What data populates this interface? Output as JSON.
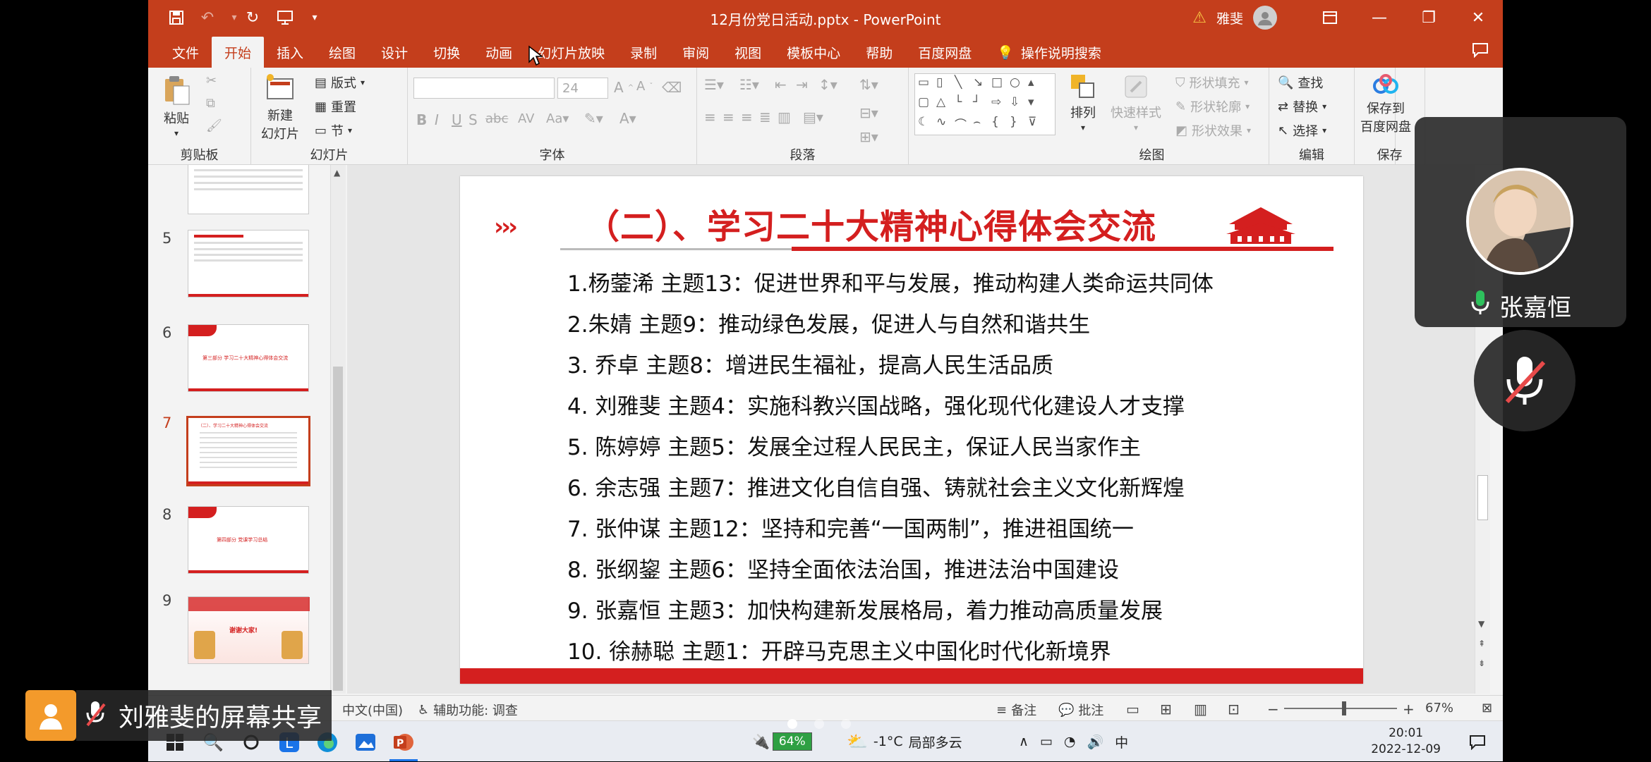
{
  "window": {
    "doc_title": "12月份党日活动.pptx  -  PowerPoint",
    "user_name": "雅斐"
  },
  "tabs": [
    "文件",
    "开始",
    "插入",
    "绘图",
    "设计",
    "切换",
    "动画",
    "幻灯片放映",
    "录制",
    "审阅",
    "视图",
    "模板中心",
    "帮助",
    "百度网盘"
  ],
  "active_tab": "开始",
  "tell_me": "操作说明搜索",
  "ribbon": {
    "clipboard": {
      "label": "剪贴板",
      "paste": "粘贴"
    },
    "slides": {
      "label": "幻灯片",
      "new_slide_1": "新建",
      "new_slide_2": "幻灯片",
      "layout": "版式",
      "reset": "重置",
      "section": "节"
    },
    "font": {
      "label": "字体",
      "size": "24"
    },
    "paragraph": {
      "label": "段落"
    },
    "drawing": {
      "label": "绘图",
      "arrange": "排列",
      "quick_styles": "快速样式",
      "fill": "形状填充",
      "outline": "形状轮廓",
      "effects": "形状效果"
    },
    "editing": {
      "label": "编辑",
      "find": "查找",
      "replace": "替换",
      "select": "选择"
    },
    "save": {
      "label": "保存",
      "save_to_1": "保存到",
      "save_to_2": "百度网盘"
    }
  },
  "thumbnails": [
    {
      "num": "5"
    },
    {
      "num": "6",
      "text": "第三部分 学习二十大精神心得体会交流"
    },
    {
      "num": "7",
      "text": "（二）、学习二十大精神心得体会交流"
    },
    {
      "num": "8",
      "text": "第四部分 党课学习总结"
    },
    {
      "num": "9",
      "text": "谢谢大家!"
    }
  ],
  "slide": {
    "title": "（二）、学习二十大精神心得体会交流",
    "items": [
      "1.杨蓥浠 主题13：促进世界和平与发展，推动构建人类命运共同体",
      "2.朱婧 主题9：推动绿色发展，促进人与自然和谐共生",
      "3. 乔卓 主题8：增进民生福祉，提高人民生活品质",
      "4. 刘雅斐 主题4：实施科教兴国战略，强化现代化建设人才支撑",
      "5. 陈婷婷 主题5：发展全过程人民民主，保证人民当家作主",
      "6. 余志强 主题7：推进文化自信自强、铸就社会主义文化新辉煌",
      "7. 张仲谋 主题12：坚持和完善“一国两制”，推进祖国统一",
      "8. 张纲鋆 主题6：坚持全面依法治国，推进法治中国建设",
      "9. 张嘉恒 主题3：加快构建新发展格局，着力推动高质量发展",
      "10. 徐赫聪 主题1：开辟马克思主义中国化时代化新境界"
    ]
  },
  "status": {
    "language": "中文(中国)",
    "accessibility": "辅助功能: 调查",
    "notes": "备注",
    "comments": "批注",
    "zoom": "67%"
  },
  "taskbar": {
    "battery": "64%",
    "weather_temp": "-1°C",
    "weather_desc": "局部多云",
    "ime": "中",
    "time": "20:01",
    "date": "2022-12-09"
  },
  "meeting": {
    "participant_name": "张嘉恒",
    "share_text": "刘雅斐的屏幕共享"
  },
  "colors": {
    "accent": "#c43e1c",
    "slide_red": "#d41f1f",
    "mic_green": "#2ec15d"
  }
}
